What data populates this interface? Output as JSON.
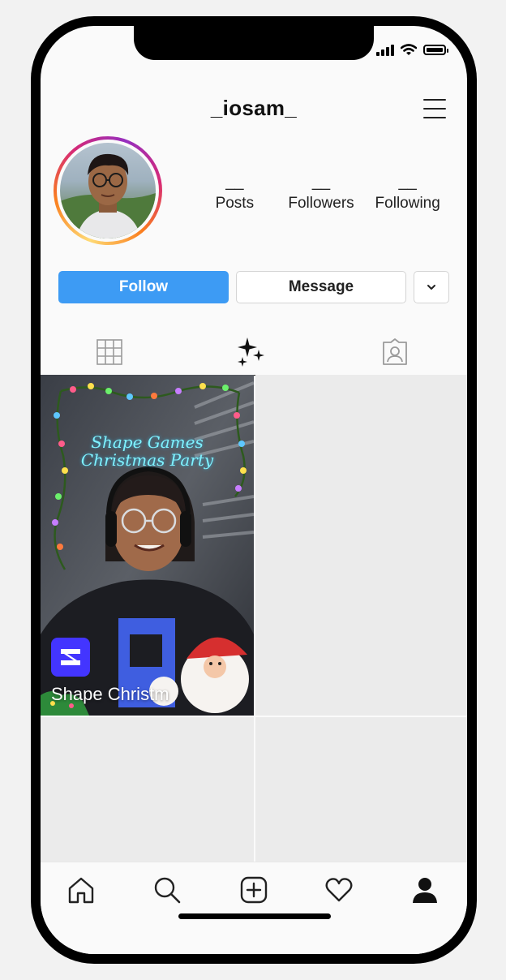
{
  "profile": {
    "username": "_iosam_",
    "stats": [
      {
        "value": "__",
        "label": "Posts"
      },
      {
        "value": "__",
        "label": "Followers"
      },
      {
        "value": "__",
        "label": "Following"
      }
    ]
  },
  "actions": {
    "follow_label": "Follow",
    "message_label": "Message"
  },
  "tabs": [
    {
      "icon": "grid-icon",
      "active": false
    },
    {
      "icon": "sparkles-icon",
      "active": true
    },
    {
      "icon": "tagged-icon",
      "active": false
    }
  ],
  "posts": [
    {
      "title_line1": "Shape Games",
      "title_line2": "Christmas Party",
      "caption": "Shape Christm"
    }
  ],
  "bottom_nav": [
    "home-icon",
    "search-icon",
    "add-post-icon",
    "activity-heart-icon",
    "profile-icon"
  ],
  "colors": {
    "follow_button": "#3d9bf4",
    "shape_logo": "#4335ff"
  }
}
